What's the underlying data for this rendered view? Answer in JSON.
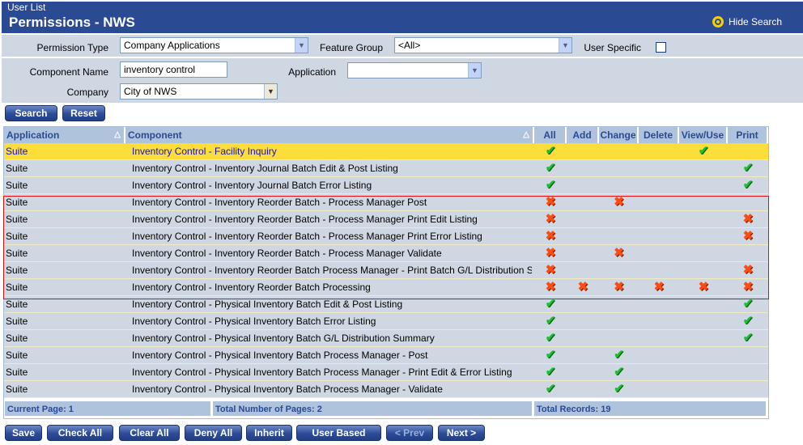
{
  "header": {
    "subtitle": "User List",
    "title": "Permissions - NWS",
    "hide_search": "Hide Search"
  },
  "filters": {
    "permission_type_label": "Permission Type",
    "permission_type": "Company Applications",
    "feature_group_label": "Feature Group",
    "feature_group": "<All>",
    "user_specific_label": "User Specific",
    "user_specific_checked": false,
    "component_name_label": "Component Name",
    "component_name": "inventory control",
    "application_label": "Application",
    "application": "",
    "company_label": "Company",
    "company": "City of NWS"
  },
  "search_buttons": {
    "search": "Search",
    "reset": "Reset"
  },
  "columns": [
    "Application",
    "Component",
    "All",
    "Add",
    "Change",
    "Delete",
    "View/Use",
    "Print"
  ],
  "rows": [
    {
      "app": "Suite",
      "component": "Inventory Control - Facility Inquiry",
      "marks": [
        "y",
        "",
        "",
        "",
        "y",
        ""
      ],
      "selected": true
    },
    {
      "app": "Suite",
      "component": "Inventory Control - Inventory Journal Batch Edit & Post Listing",
      "marks": [
        "y",
        "",
        "",
        "",
        "",
        "y"
      ]
    },
    {
      "app": "Suite",
      "component": "Inventory Control - Inventory Journal Batch Error Listing",
      "marks": [
        "y",
        "",
        "",
        "",
        "",
        "y"
      ]
    },
    {
      "app": "Suite",
      "component": "Inventory Control - Inventory Reorder Batch - Process Manager Post",
      "marks": [
        "n",
        "",
        "n",
        "",
        "",
        ""
      ]
    },
    {
      "app": "Suite",
      "component": "Inventory Control - Inventory Reorder Batch - Process Manager Print Edit Listing",
      "marks": [
        "n",
        "",
        "",
        "",
        "",
        "n"
      ]
    },
    {
      "app": "Suite",
      "component": "Inventory Control - Inventory Reorder Batch - Process Manager Print Error Listing",
      "marks": [
        "n",
        "",
        "",
        "",
        "",
        "n"
      ]
    },
    {
      "app": "Suite",
      "component": "Inventory Control - Inventory Reorder Batch - Process Manager Validate",
      "marks": [
        "n",
        "",
        "n",
        "",
        "",
        ""
      ]
    },
    {
      "app": "Suite",
      "component": "Inventory Control - Inventory Reorder Batch Process Manager - Print Batch G/L Distribution Summary",
      "marks": [
        "n",
        "",
        "",
        "",
        "",
        "n"
      ]
    },
    {
      "app": "Suite",
      "component": "Inventory Control - Inventory Reorder Batch Processing",
      "marks": [
        "n",
        "n",
        "n",
        "n",
        "n",
        "n"
      ]
    },
    {
      "app": "Suite",
      "component": "Inventory Control - Physical Inventory Batch Edit & Post Listing",
      "marks": [
        "y",
        "",
        "",
        "",
        "",
        "y"
      ]
    },
    {
      "app": "Suite",
      "component": "Inventory Control - Physical Inventory Batch Error Listing",
      "marks": [
        "y",
        "",
        "",
        "",
        "",
        "y"
      ]
    },
    {
      "app": "Suite",
      "component": "Inventory Control - Physical Inventory Batch G/L Distribution Summary",
      "marks": [
        "y",
        "",
        "",
        "",
        "",
        "y"
      ]
    },
    {
      "app": "Suite",
      "component": "Inventory Control - Physical Inventory Batch Process Manager - Post",
      "marks": [
        "y",
        "",
        "y",
        "",
        "",
        ""
      ]
    },
    {
      "app": "Suite",
      "component": "Inventory Control - Physical Inventory Batch Process Manager - Print Edit & Error Listing",
      "marks": [
        "y",
        "",
        "y",
        "",
        "",
        ""
      ]
    },
    {
      "app": "Suite",
      "component": "Inventory Control - Physical Inventory Batch Process Manager - Validate",
      "marks": [
        "y",
        "",
        "y",
        "",
        "",
        ""
      ]
    }
  ],
  "footer": {
    "current_page": "Current Page: 1",
    "total_pages": "Total Number of Pages: 2",
    "total_records": "Total Records: 19"
  },
  "actions": [
    "Save",
    "Check All",
    "Clear All",
    "Deny All",
    "Inherit",
    "User Based",
    "< Prev",
    "Next >"
  ],
  "colors": {
    "header": "#2a4a94",
    "selected_row": "#fddd3a",
    "row": "#cfd7e3",
    "allow": "#19c030",
    "deny": "#ff4a10",
    "highlight_box": "#e01010"
  }
}
